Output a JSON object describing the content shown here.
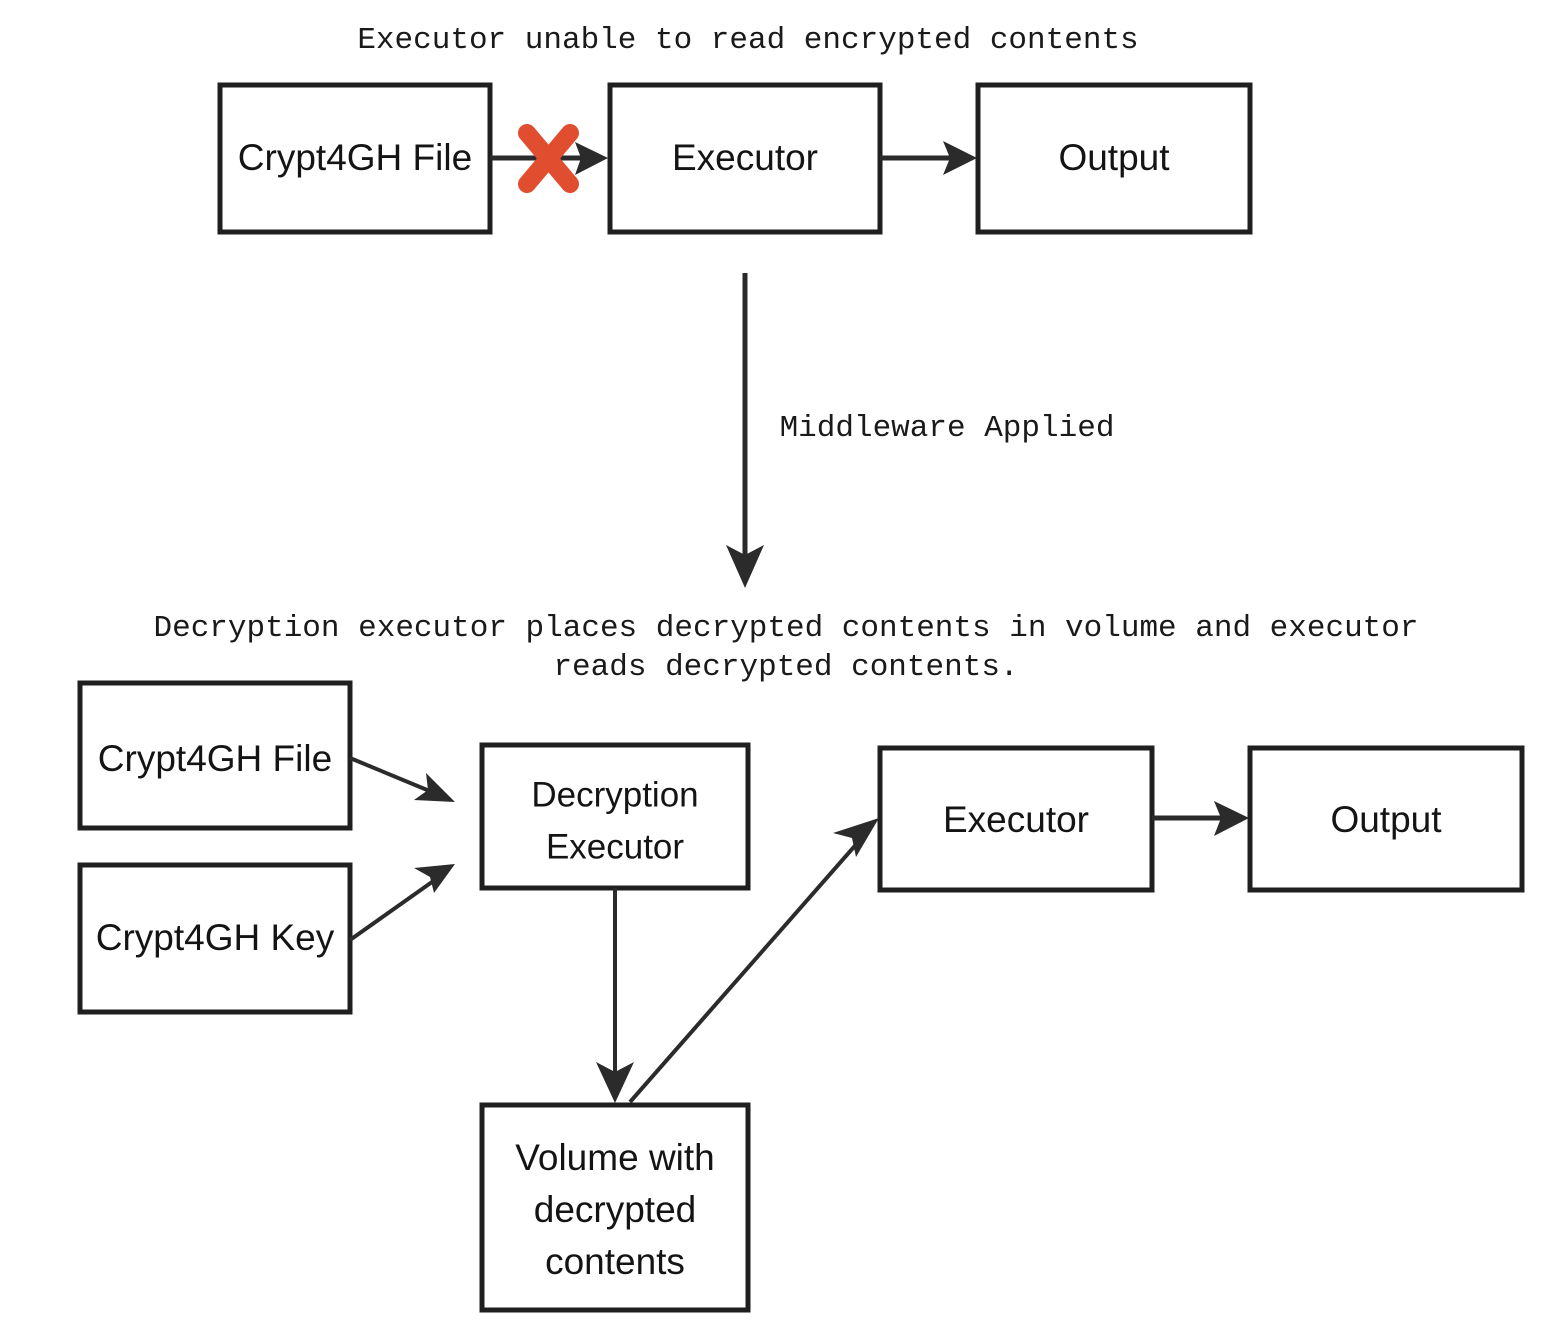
{
  "diagram": {
    "title_top": "Executor unable to read encrypted contents",
    "transition_label": "Middleware Applied",
    "title_bottom_line1": "Decryption executor places decrypted contents in volume and executor",
    "title_bottom_line2": "reads decrypted contents.",
    "colors": {
      "box_stroke": "#1f1f1f",
      "text": "#141414",
      "arrow": "#2b2b2b",
      "cross": "#e04e2f",
      "background": "#ffffff"
    },
    "top_flow": {
      "nodes": [
        {
          "id": "crypt4gh-file-top",
          "label": "Crypt4GH File"
        },
        {
          "id": "executor-top",
          "label": "Executor"
        },
        {
          "id": "output-top",
          "label": "Output"
        }
      ],
      "blocked_edge": {
        "from": "crypt4gh-file-top",
        "to": "executor-top",
        "marker": "x-cross",
        "blocked": true
      },
      "edges": [
        {
          "from": "executor-top",
          "to": "output-top",
          "blocked": false
        }
      ]
    },
    "bottom_flow": {
      "nodes": [
        {
          "id": "crypt4gh-file-bottom",
          "label": "Crypt4GH File"
        },
        {
          "id": "crypt4gh-key-bottom",
          "label": "Crypt4GH Key"
        },
        {
          "id": "decryption-executor",
          "label_line1": "Decryption",
          "label_line2": "Executor"
        },
        {
          "id": "executor-bottom",
          "label": "Executor"
        },
        {
          "id": "output-bottom",
          "label": "Output"
        },
        {
          "id": "volume-decrypted",
          "label_line1": "Volume with",
          "label_line2": "decrypted",
          "label_line3": "contents"
        }
      ],
      "edges": [
        {
          "from": "crypt4gh-file-bottom",
          "to": "decryption-executor"
        },
        {
          "from": "crypt4gh-key-bottom",
          "to": "decryption-executor"
        },
        {
          "from": "decryption-executor",
          "to": "volume-decrypted"
        },
        {
          "from": "volume-decrypted",
          "to": "executor-bottom"
        },
        {
          "from": "executor-bottom",
          "to": "output-bottom"
        }
      ]
    }
  }
}
